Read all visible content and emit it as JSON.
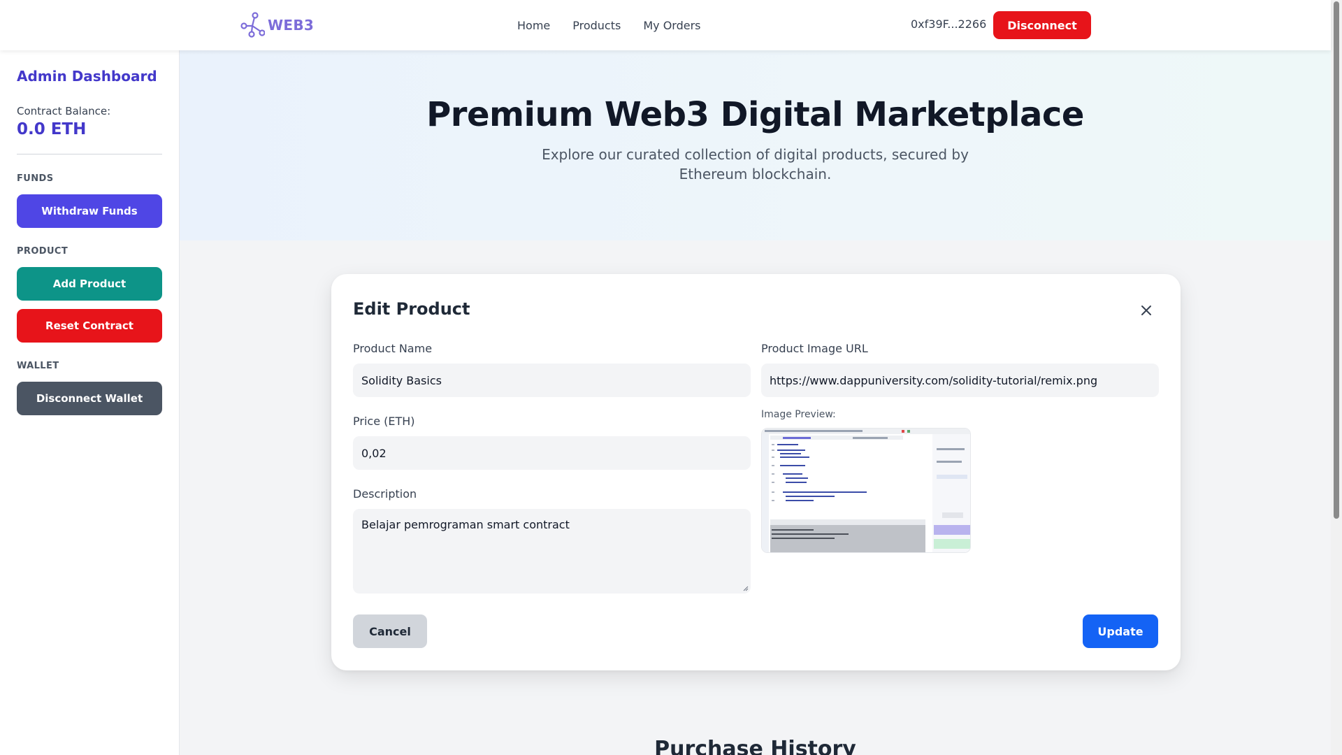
{
  "navbar": {
    "logo_text": "WEB3",
    "links": [
      "Home",
      "Products",
      "My Orders"
    ],
    "wallet_address": "0xf39F...2266",
    "disconnect_label": "Disconnect"
  },
  "sidebar": {
    "title": "Admin Dashboard",
    "balance_label": "Contract Balance:",
    "balance_value": "0.0 ETH",
    "sections": {
      "funds": "FUNDS",
      "product": "PRODUCT",
      "wallet": "WALLET"
    },
    "buttons": {
      "withdraw": "Withdraw Funds",
      "add_product": "Add Product",
      "reset_contract": "Reset Contract",
      "disconnect_wallet": "Disconnect Wallet"
    }
  },
  "hero": {
    "title": "Premium Web3 Digital Marketplace",
    "subtitle": "Explore our curated collection of digital products, secured by Ethereum blockchain."
  },
  "modal": {
    "title": "Edit Product",
    "product_name_label": "Product Name",
    "product_name_value": "Solidity Basics",
    "price_label": "Price (ETH)",
    "price_value": "0,02",
    "description_label": "Description",
    "description_value": "Belajar pemrograman smart contract",
    "image_url_label": "Product Image URL",
    "image_url_value": "https://www.dappuniversity.com/solidity-tutorial/remix.png",
    "preview_label": "Image Preview:",
    "cancel_label": "Cancel",
    "update_label": "Update"
  },
  "history": {
    "title": "Purchase History"
  },
  "colors": {
    "brand": "#7c6cd9",
    "indigo": "#4338ca",
    "withdraw": "#4f46e5",
    "add_product": "#0d9488",
    "danger": "#e7141a",
    "dark": "#4b5563",
    "update": "#1463f5"
  },
  "icons": {
    "logo": "network-nodes-icon",
    "close": "close-icon"
  }
}
